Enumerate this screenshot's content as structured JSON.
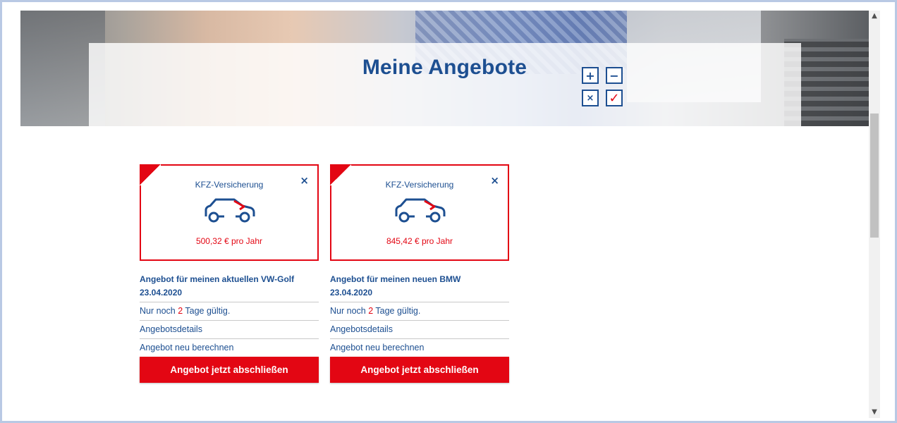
{
  "hero": {
    "title": "Meine Angebote",
    "calculator_keys": [
      "+",
      "−",
      "×",
      "✓"
    ]
  },
  "colors": {
    "brand_blue": "#1d4f91",
    "brand_red": "#e30613",
    "divider": "#c9c9c9"
  },
  "offers": [
    {
      "product": "KFZ-Versicherung",
      "close_label": "×",
      "price": "500,32 € pro Jahr",
      "name": "Angebot für meinen aktuellen VW-Golf",
      "date": "23.04.2020",
      "validity_prefix": "Nur noch ",
      "validity_days": "2",
      "validity_suffix": " Tage gültig.",
      "details_link": "Angebotsdetails",
      "recalc_link": "Angebot neu berechnen",
      "cta": "Angebot jetzt abschließen"
    },
    {
      "product": "KFZ-Versicherung",
      "close_label": "×",
      "price": "845,42 € pro Jahr",
      "name": "Angebot für meinen neuen BMW",
      "date": "23.04.2020",
      "validity_prefix": "Nur noch ",
      "validity_days": "2",
      "validity_suffix": " Tage gültig.",
      "details_link": "Angebotsdetails",
      "recalc_link": "Angebot neu berechnen",
      "cta": "Angebot jetzt abschließen"
    }
  ],
  "scrollbar": {
    "up_icon": "▲",
    "down_icon": "▼"
  }
}
